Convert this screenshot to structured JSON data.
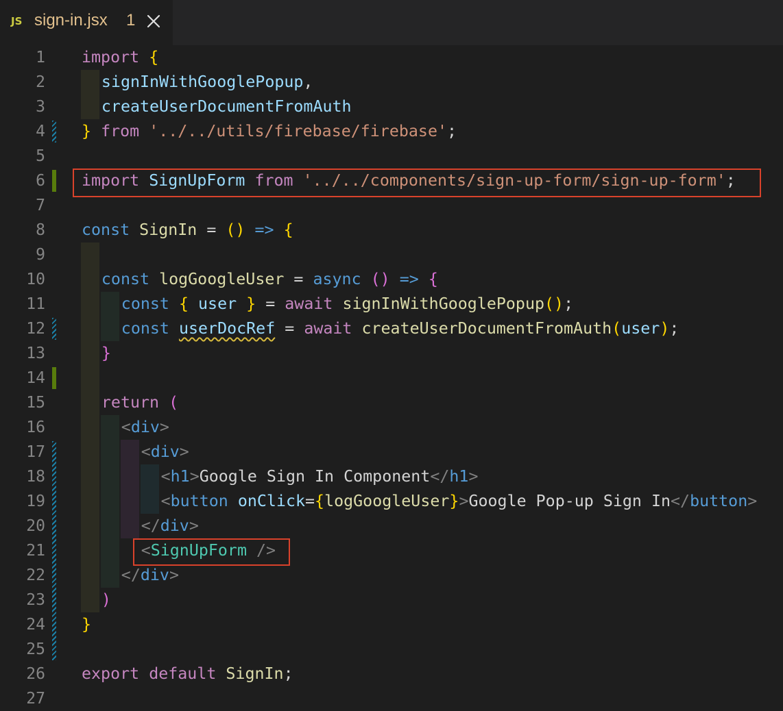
{
  "tab": {
    "icon": "JS",
    "filename": "sign-in.jsx",
    "problems": "1",
    "close": "✕",
    "icon_color": "#cbcb41",
    "title_color": "#e2c08d"
  },
  "line_numbers": [
    "1",
    "2",
    "3",
    "4",
    "5",
    "6",
    "7",
    "8",
    "9",
    "10",
    "11",
    "12",
    "13",
    "14",
    "15",
    "16",
    "17",
    "18",
    "19",
    "20",
    "21",
    "22",
    "23",
    "24",
    "25",
    "26",
    "27"
  ],
  "lines": [
    [
      [
        "kw",
        "import"
      ],
      [
        "txt",
        " "
      ],
      [
        "b1",
        "{"
      ]
    ],
    [
      [
        "var",
        "signInWithGooglePopup"
      ],
      [
        "txt",
        ","
      ]
    ],
    [
      [
        "var",
        "createUserDocumentFromAuth"
      ]
    ],
    [
      [
        "b1",
        "}"
      ],
      [
        "txt",
        " "
      ],
      [
        "kw",
        "from"
      ],
      [
        "txt",
        " "
      ],
      [
        "str",
        "'../../utils/firebase/firebase'"
      ],
      [
        "txt",
        ";"
      ]
    ],
    [],
    [
      [
        "kw",
        "import"
      ],
      [
        "txt",
        " "
      ],
      [
        "var",
        "SignUpForm"
      ],
      [
        "txt",
        " "
      ],
      [
        "kw",
        "from"
      ],
      [
        "txt",
        " "
      ],
      [
        "str",
        "'../../components/sign-up-form/sign-up-form'"
      ],
      [
        "txt",
        ";"
      ]
    ],
    [],
    [
      [
        "dk",
        "const"
      ],
      [
        "txt",
        " "
      ],
      [
        "fn",
        "SignIn"
      ],
      [
        "txt",
        " = "
      ],
      [
        "b1",
        "()"
      ],
      [
        "txt",
        " "
      ],
      [
        "dk",
        "=>"
      ],
      [
        "txt",
        " "
      ],
      [
        "b1",
        "{"
      ]
    ],
    [],
    [
      [
        "dk",
        "const"
      ],
      [
        "txt",
        " "
      ],
      [
        "fn",
        "logGoogleUser"
      ],
      [
        "txt",
        " = "
      ],
      [
        "dk",
        "async"
      ],
      [
        "txt",
        " "
      ],
      [
        "b2",
        "()"
      ],
      [
        "txt",
        " "
      ],
      [
        "dk",
        "=>"
      ],
      [
        "txt",
        " "
      ],
      [
        "b2",
        "{"
      ]
    ],
    [
      [
        "dk",
        "const"
      ],
      [
        "txt",
        " "
      ],
      [
        "b1",
        "{"
      ],
      [
        "txt",
        " "
      ],
      [
        "var",
        "user"
      ],
      [
        "txt",
        " "
      ],
      [
        "b1",
        "}"
      ],
      [
        "txt",
        " = "
      ],
      [
        "kw",
        "await"
      ],
      [
        "txt",
        " "
      ],
      [
        "fn",
        "signInWithGooglePopup"
      ],
      [
        "b1",
        "()"
      ],
      [
        "txt",
        ";"
      ]
    ],
    [
      [
        "dk",
        "const"
      ],
      [
        "txt",
        " "
      ],
      [
        "varsq",
        "userDocRef"
      ],
      [
        "txt",
        " = "
      ],
      [
        "kw",
        "await"
      ],
      [
        "txt",
        " "
      ],
      [
        "fn",
        "createUserDocumentFromAuth"
      ],
      [
        "b1",
        "("
      ],
      [
        "var",
        "user"
      ],
      [
        "b1",
        ")"
      ],
      [
        "txt",
        ";"
      ]
    ],
    [
      [
        "b2",
        "}"
      ]
    ],
    [],
    [
      [
        "kw",
        "return"
      ],
      [
        "txt",
        " "
      ],
      [
        "b2",
        "("
      ]
    ],
    [
      [
        "pun",
        "<"
      ],
      [
        "tag",
        "div"
      ],
      [
        "pun",
        ">"
      ]
    ],
    [
      [
        "pun",
        "<"
      ],
      [
        "tag",
        "div"
      ],
      [
        "pun",
        ">"
      ]
    ],
    [
      [
        "pun",
        "<"
      ],
      [
        "tag",
        "h1"
      ],
      [
        "pun",
        ">"
      ],
      [
        "txt",
        "Google Sign In Component"
      ],
      [
        "pun",
        "</"
      ],
      [
        "tag",
        "h1"
      ],
      [
        "pun",
        ">"
      ]
    ],
    [
      [
        "pun",
        "<"
      ],
      [
        "tag",
        "button"
      ],
      [
        "txt",
        " "
      ],
      [
        "attr",
        "onClick"
      ],
      [
        "txt",
        "="
      ],
      [
        "b1",
        "{"
      ],
      [
        "fn",
        "logGoogleUser"
      ],
      [
        "b1",
        "}"
      ],
      [
        "pun",
        ">"
      ],
      [
        "txt",
        "Google Pop-up Sign In"
      ],
      [
        "pun",
        "</"
      ],
      [
        "tag",
        "button"
      ],
      [
        "pun",
        ">"
      ]
    ],
    [
      [
        "pun",
        "</"
      ],
      [
        "tag",
        "div"
      ],
      [
        "pun",
        ">"
      ]
    ],
    [
      [
        "pun",
        "<"
      ],
      [
        "cmp",
        "SignUpForm"
      ],
      [
        "txt",
        " "
      ],
      [
        "pun",
        "/>"
      ]
    ],
    [
      [
        "pun",
        "</"
      ],
      [
        "tag",
        "div"
      ],
      [
        "pun",
        ">"
      ]
    ],
    [
      [
        "b2",
        ")"
      ]
    ],
    [
      [
        "b1",
        "}"
      ]
    ],
    [],
    [
      [
        "kw",
        "export"
      ],
      [
        "txt",
        " "
      ],
      [
        "kw",
        "default"
      ],
      [
        "txt",
        " "
      ],
      [
        "fn",
        "SignIn"
      ],
      [
        "txt",
        ";"
      ]
    ],
    []
  ],
  "colors": {
    "background": "#1e1e1e",
    "highlight_box": "#d9422b",
    "git_added": "#587c0c",
    "git_modified": "#1b81a8"
  }
}
